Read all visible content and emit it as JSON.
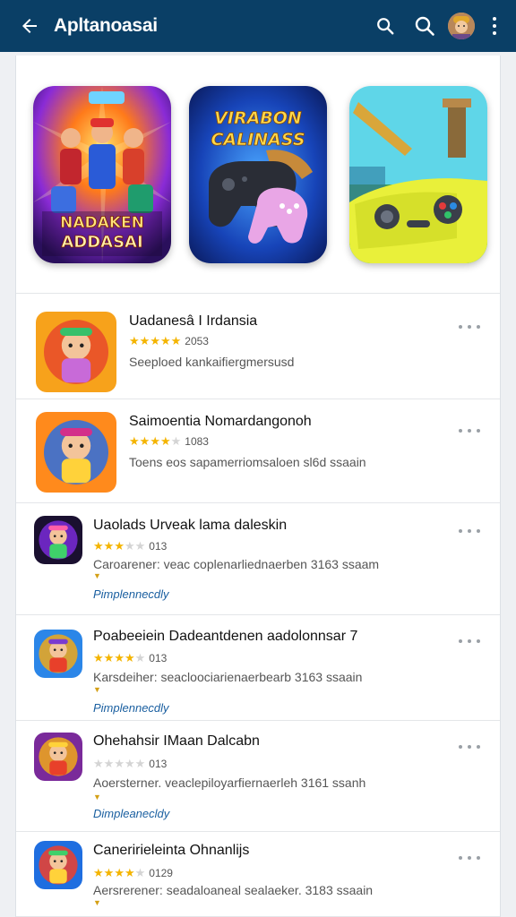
{
  "header": {
    "title": "Apltanoasai"
  },
  "featured": [
    {
      "lines": [
        "NADAKEN",
        "ADDASAI"
      ]
    },
    {
      "lines": [
        "VIRABON",
        "CALINASS"
      ]
    },
    {
      "lines": []
    }
  ],
  "apps": [
    {
      "name": "Uadanesâ I Irdansia",
      "stars_filled": 5,
      "rating": "2053",
      "desc": "Seeploed kankaifiergmersusd",
      "link": ""
    },
    {
      "name": "Saimoentia Nomardangonoh",
      "stars_filled": 4,
      "rating": "1083",
      "desc": "Toens eos sapamerriomsaloen sl6d ssaain",
      "link": ""
    },
    {
      "name": "Uaolads Urveak lama daleskin",
      "stars_filled": 3,
      "rating": "013",
      "desc": "Caroarener: veac coplenarliednaerben 3163 ssaam",
      "link": "Pimplennecdly"
    },
    {
      "name": "Poabeeiein Dadeantdenen aadolonnsar 7",
      "stars_filled": 4,
      "rating": "013",
      "desc": "Karsdeiher: seacloociarienaerbearb 3163 ssaain",
      "link": "Pimplennecdly"
    },
    {
      "name": "Ohehahsir IMaan Dalcabn",
      "stars_filled": 0,
      "rating": "013",
      "desc": "Aoersterner. veaclepiloyarfiernaerleh 3161 ssanh",
      "link": "Dimpleanecldy"
    },
    {
      "name": "Caneririeleinta Ohnanlijs",
      "stars_filled": 4,
      "rating": "0129",
      "desc": "Aersrerener: seadaloaneal sealaeker. 3183 ssaain",
      "link": ""
    }
  ]
}
